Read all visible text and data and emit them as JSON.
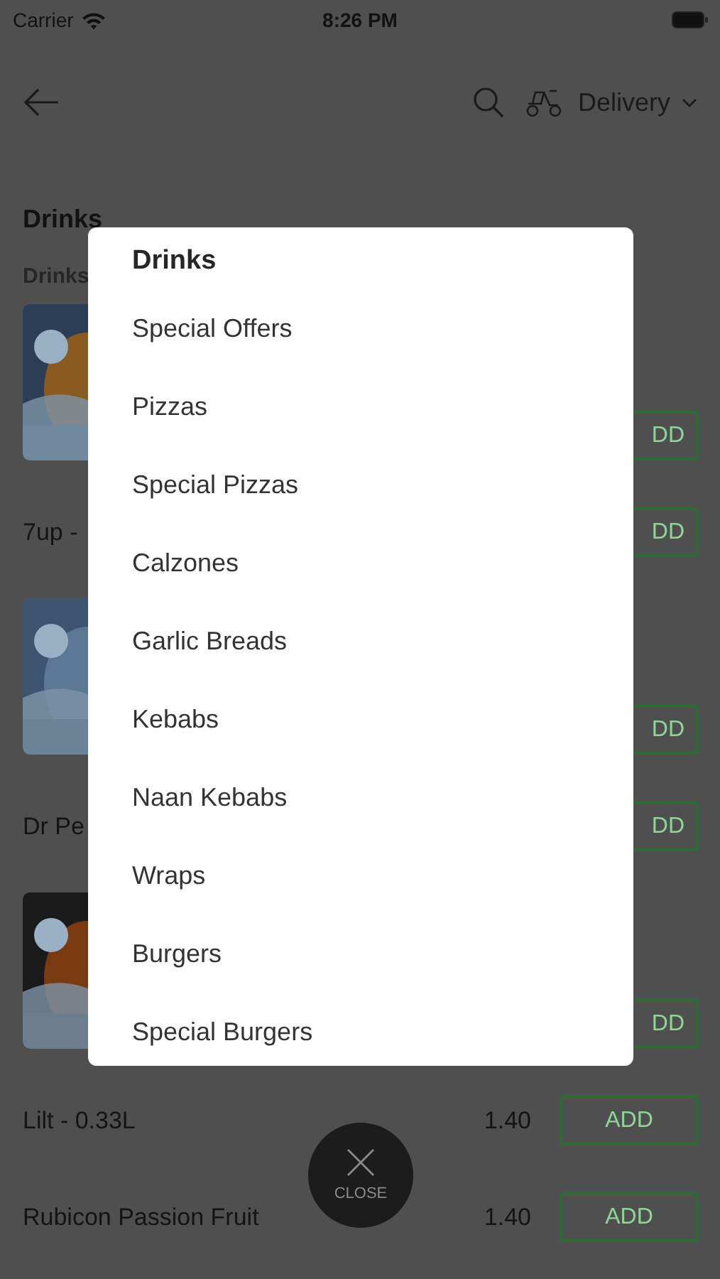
{
  "status_bar": {
    "carrier": "Carrier",
    "time": "8:26 PM"
  },
  "header": {
    "delivery_mode": "Delivery"
  },
  "category": {
    "title": "Drinks",
    "subtitle": "Drinks"
  },
  "items": [
    {
      "kind": "image_row",
      "button": "DD"
    },
    {
      "kind": "text_row",
      "name": "7up -",
      "button": "DD"
    },
    {
      "kind": "image_row",
      "button": "DD"
    },
    {
      "kind": "text_row",
      "name": "Dr Pe",
      "button": "DD"
    },
    {
      "kind": "image_row",
      "button": "DD"
    },
    {
      "kind": "text_row",
      "name": "Lilt - 0.33L",
      "price": "1.40",
      "button": "ADD"
    },
    {
      "kind": "text_row",
      "name": "Rubicon Passion Fruit",
      "price": "1.40",
      "button": "ADD"
    }
  ],
  "category_menu": {
    "title": "Drinks",
    "items": [
      "Special Offers",
      "Pizzas",
      "Special Pizzas",
      "Calzones",
      "Garlic Breads",
      "Kebabs",
      "Naan Kebabs",
      "Wraps",
      "Burgers",
      "Special Burgers"
    ]
  },
  "close_button": {
    "label": "CLOSE"
  }
}
